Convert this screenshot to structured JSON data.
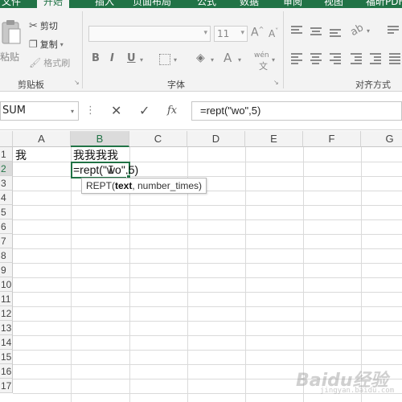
{
  "tabs": [
    "文件",
    "开始",
    "插入",
    "页面布局",
    "公式",
    "数据",
    "审阅",
    "视图",
    "福昕PDF"
  ],
  "active_tab_index": 1,
  "ribbon": {
    "clipboard": {
      "paste": "粘贴",
      "cut": "剪切",
      "copy": "复制",
      "format_painter": "格式刷",
      "group_label": "剪贴板"
    },
    "font": {
      "size": "11",
      "group_label": "字体",
      "bold": "B",
      "italic": "I",
      "underline": "U",
      "font_color_letter": "A",
      "increase_font": "A",
      "decrease_font": "A",
      "phonetic": "wén"
    },
    "alignment": {
      "group_label": "对齐方式"
    }
  },
  "formula_bar": {
    "name_box": "SUM",
    "cancel": "✕",
    "enter": "✓",
    "fx": "fx",
    "content": "=rept(\"wo\",5)"
  },
  "grid": {
    "columns": [
      "A",
      "B",
      "C",
      "D",
      "E",
      "F",
      "G"
    ],
    "rows": [
      "1",
      "2",
      "3",
      "4",
      "5",
      "6",
      "7",
      "8",
      "9",
      "10",
      "11",
      "12",
      "13",
      "14",
      "15",
      "16",
      "17"
    ],
    "a1": "我",
    "b1": "我我我我",
    "b2_editing": "=rept(\"wo\",5)",
    "tooltip": {
      "func": "REPT(",
      "arg1": "text",
      "rest": ", number_times)"
    }
  },
  "watermark": {
    "text": "Baidu经验",
    "sub": "jingyan.baidu.com"
  },
  "colors": {
    "accent": "#217346",
    "ribbon_bg": "#f3f3f3",
    "header_bg": "#f3f3f3"
  }
}
